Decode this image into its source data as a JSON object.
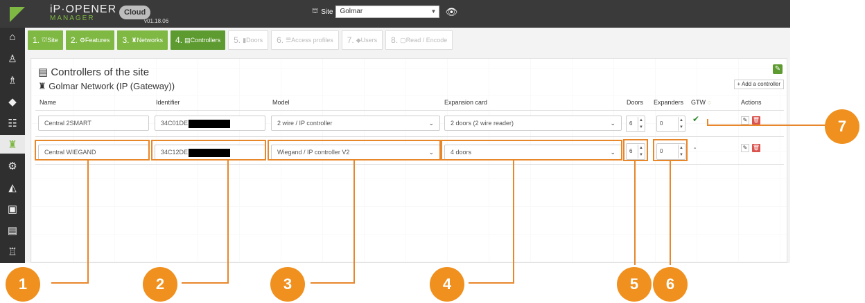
{
  "app": {
    "logo_line1": "iP·OPENER",
    "logo_line2": "MANAGER",
    "cloud": "Cloud",
    "version": "v01.18.06"
  },
  "site": {
    "label": "Site",
    "value": "Golmar"
  },
  "steps": [
    {
      "num": "1.",
      "label": "Site"
    },
    {
      "num": "2.",
      "label": "Features"
    },
    {
      "num": "3.",
      "label": "Networks"
    },
    {
      "num": "4.",
      "label": "Controllers"
    },
    {
      "num": "5.",
      "label": "Doors"
    },
    {
      "num": "6.",
      "label": "Access profiles"
    },
    {
      "num": "7.",
      "label": "Users"
    },
    {
      "num": "8.",
      "label": "Read / Encode"
    }
  ],
  "panel": {
    "title": "Controllers of the site",
    "network": "Golmar Network (IP (Gateway))",
    "add_button": "+ Add a controller"
  },
  "columns": {
    "name": "Name",
    "identifier": "Identifier",
    "model": "Model",
    "expansion": "Expansion card",
    "doors": "Doors",
    "expanders": "Expanders",
    "gtw": "GTW",
    "actions": "Actions"
  },
  "rows": [
    {
      "name": "Central 2SMART",
      "identifier": "34C01DE",
      "model": "2 wire / IP controller",
      "expansion": "2 doors (2 wire reader)",
      "doors": "6",
      "expanders": "0",
      "gtw": "✔"
    },
    {
      "name": "Central WIEGAND",
      "identifier": "34C12DE",
      "model": "Wiegand / IP controller V2",
      "expansion": "4 doors",
      "doors": "6",
      "expanders": "0",
      "gtw": "-"
    }
  ],
  "callouts": [
    "1",
    "2",
    "3",
    "4",
    "5",
    "6",
    "7"
  ],
  "colors": {
    "accent_green": "#7fb843",
    "callout_orange": "#f0901e",
    "delete_red": "#d9534f",
    "topbar": "#3a3a3a"
  }
}
